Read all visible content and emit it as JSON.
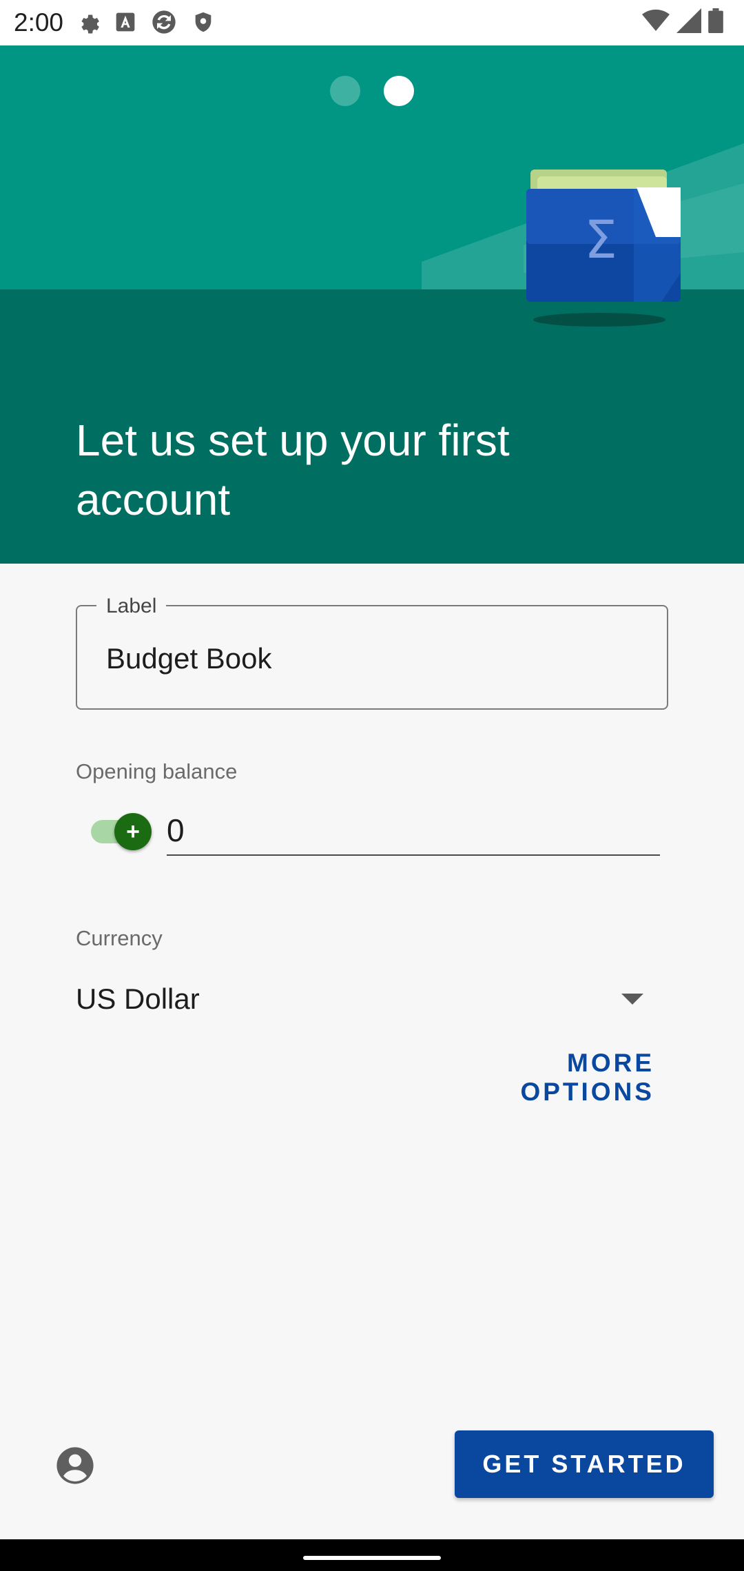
{
  "status_bar": {
    "time": "2:00",
    "left_icons": [
      "settings-icon",
      "font-a-icon",
      "sync-icon",
      "shield-icon"
    ],
    "right_icons": [
      "wifi-icon",
      "signal-icon",
      "battery-icon"
    ]
  },
  "onboarding": {
    "page_count": 2,
    "current_page": 2,
    "title": "Let us set up your first account"
  },
  "form": {
    "label": {
      "legend": "Label",
      "value": "Budget Book"
    },
    "opening_balance": {
      "title": "Opening balance",
      "sign_toggle_symbol": "+",
      "sign_positive": true,
      "value": "0"
    },
    "currency": {
      "title": "Currency",
      "value": "US Dollar"
    },
    "more_options_label": "MORE OPTIONS"
  },
  "footer": {
    "get_started_label": "GET STARTED",
    "account_icon": "account-circle-icon"
  },
  "colors": {
    "header_top": "#009683",
    "header_bottom": "#006e60",
    "accent_blue": "#0a48a0",
    "toggle_green": "#1b6b12"
  }
}
